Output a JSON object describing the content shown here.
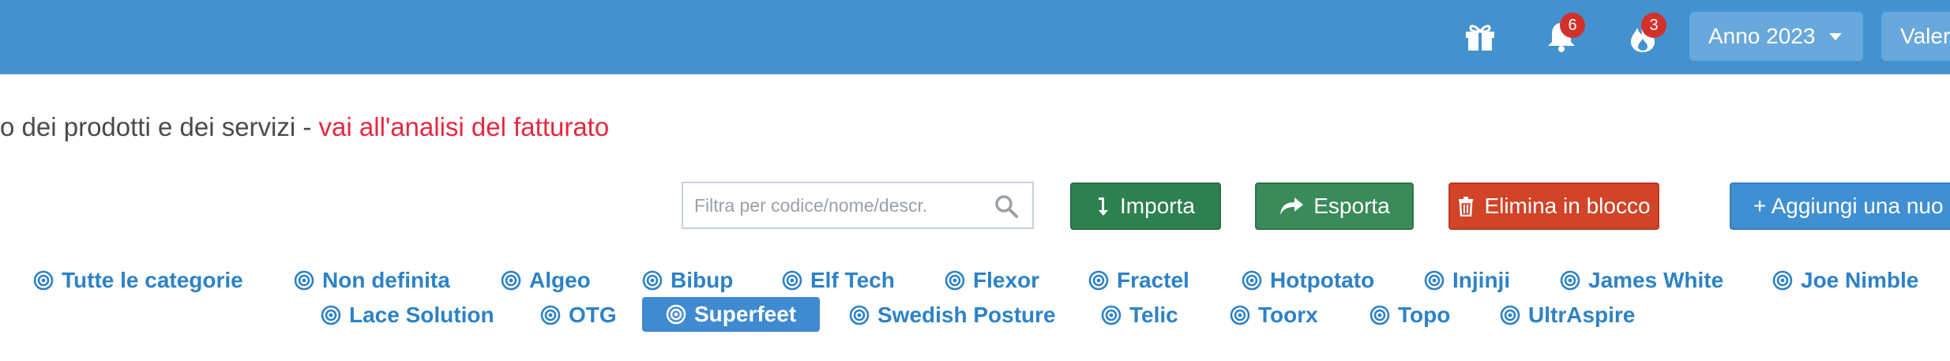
{
  "topbar": {
    "notifications_count": "6",
    "alerts_count": "3",
    "year_label": "Anno 2023",
    "user_label": "Valer"
  },
  "subtitle": {
    "text": "o dei prodotti e dei servizi - ",
    "link": "vai all'analisi del fatturato"
  },
  "search": {
    "placeholder": "Filtra per codice/nome/descr."
  },
  "actions": {
    "import": "Importa",
    "export": "Esporta",
    "delete": "Elimina in blocco",
    "add": "+ Aggiungi una nuo"
  },
  "categories": [
    "Tutte le categorie",
    "Non definita",
    "Algeo",
    "Bibup",
    "Elf Tech",
    "Flexor",
    "Fractel",
    "Hotpotato",
    "Injinji",
    "James White",
    "Joe Nimble",
    "Lace Solution",
    "OTG",
    "Superfeet",
    "Swedish Posture",
    "Telic",
    "Toorx",
    "Topo",
    "UltrAspire"
  ],
  "active_category": "Superfeet",
  "colors": {
    "topbar": "#4392cf",
    "badge": "#d2302a",
    "link": "#e5283f",
    "category": "#2d82c7",
    "import": "#2d8050",
    "export": "#3a8a5a",
    "delete": "#d14428",
    "add": "#3f8fd2"
  }
}
